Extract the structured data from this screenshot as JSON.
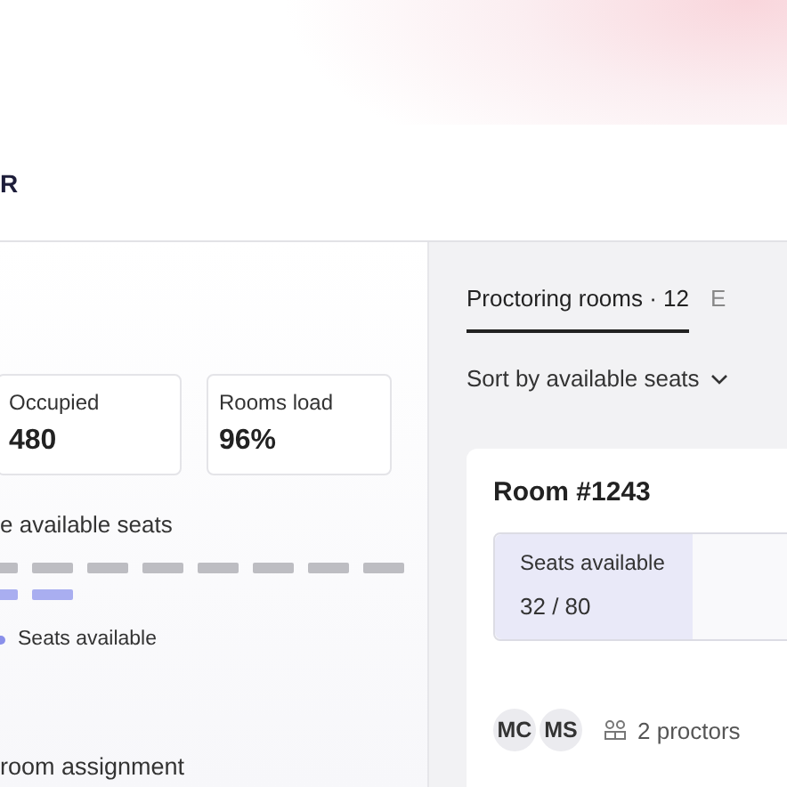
{
  "header": {
    "title": "R"
  },
  "stats": [
    {
      "label": "Occupied",
      "value": "480"
    },
    {
      "label": "Rooms load",
      "value": "96%"
    }
  ],
  "seat_map": {
    "title": "e available seats",
    "seats": [
      {
        "available": false
      },
      {
        "available": false
      },
      {
        "available": false
      },
      {
        "available": false
      },
      {
        "available": false
      },
      {
        "available": false
      },
      {
        "available": false
      },
      {
        "available": false
      },
      {
        "available": true
      },
      {
        "available": true
      }
    ],
    "legend": "Seats available"
  },
  "section_title": "room assignment",
  "tabs": [
    {
      "label": "Proctoring rooms · 12",
      "selected": true
    },
    {
      "label": "E",
      "selected": false
    }
  ],
  "sort": {
    "label": "Sort by available seats"
  },
  "room": {
    "title": "Room #1243",
    "seats_label": "Seats available",
    "seats_value": "32 / 80",
    "level": 0.56,
    "proctors": [
      "MC",
      "MS"
    ],
    "proctor_count": "2 proctors"
  }
}
